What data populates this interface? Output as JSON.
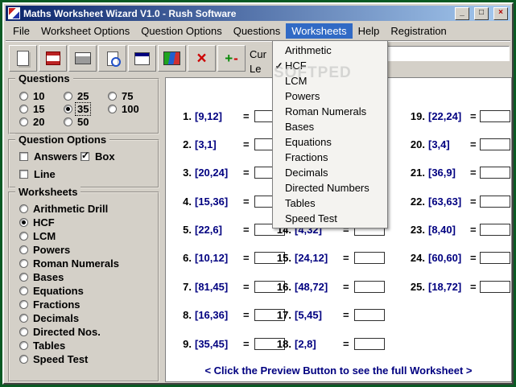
{
  "window": {
    "title": "Maths Worksheet Wizard V1.0 - Rush Software",
    "buttons": {
      "minimize": "_",
      "maximize": "□",
      "close": "×"
    }
  },
  "menubar": {
    "items": [
      {
        "label": "File",
        "active": false
      },
      {
        "label": "Worksheet Options",
        "active": false
      },
      {
        "label": "Question Options",
        "active": false
      },
      {
        "label": "Questions",
        "active": false
      },
      {
        "label": "Worksheets",
        "active": true
      },
      {
        "label": "Help",
        "active": false
      },
      {
        "label": "Registration",
        "active": false
      }
    ]
  },
  "dropdown": {
    "items": [
      {
        "label": "Arithmetic",
        "check": ""
      },
      {
        "label": "HCF",
        "check": "✓"
      },
      {
        "label": "LCM",
        "check": ""
      },
      {
        "label": "Powers",
        "check": ""
      },
      {
        "label": "Roman Numerals",
        "check": ""
      },
      {
        "label": "Bases",
        "check": ""
      },
      {
        "label": "Equations",
        "check": ""
      },
      {
        "label": "Fractions",
        "check": ""
      },
      {
        "label": "Decimals",
        "check": ""
      },
      {
        "label": "Directed Numbers",
        "check": ""
      },
      {
        "label": "Tables",
        "check": ""
      },
      {
        "label": "Speed Test",
        "check": ""
      }
    ]
  },
  "toolbar": {
    "buttons": [
      {
        "icon": "new-worksheet-icon"
      },
      {
        "icon": "save-worksheet-icon"
      },
      {
        "icon": "print-icon"
      },
      {
        "icon": "print-preview-icon"
      },
      {
        "icon": "preview-window-icon"
      },
      {
        "icon": "worksheet-image-icon"
      },
      {
        "icon": "delete-icon"
      },
      {
        "icon": "exit-icon"
      }
    ],
    "label_current": "Cur",
    "label_level": "Le",
    "input_value": ""
  },
  "panels": {
    "questions": {
      "title": "Questions",
      "options": [
        {
          "label": "10",
          "selected": false,
          "focused": false
        },
        {
          "label": "15",
          "selected": false,
          "focused": false
        },
        {
          "label": "20",
          "selected": false,
          "focused": false
        },
        {
          "label": "25",
          "selected": false,
          "focused": false
        },
        {
          "label": "35",
          "selected": true,
          "focused": true
        },
        {
          "label": "50",
          "selected": false,
          "focused": false
        },
        {
          "label": "75",
          "selected": false,
          "focused": false
        },
        {
          "label": "100",
          "selected": false,
          "focused": false
        }
      ]
    },
    "question_options": {
      "title": "Question Options",
      "checkboxes": [
        {
          "label": "Answers",
          "checked": false
        },
        {
          "label": "Box",
          "checked": true
        },
        {
          "label": "Line",
          "checked": false
        }
      ]
    },
    "worksheets": {
      "title": "Worksheets",
      "options": [
        {
          "label": "Arithmetic Drill",
          "selected": false
        },
        {
          "label": "HCF",
          "selected": true
        },
        {
          "label": "LCM",
          "selected": false
        },
        {
          "label": "Powers",
          "selected": false
        },
        {
          "label": "Roman Numerals",
          "selected": false
        },
        {
          "label": "Bases",
          "selected": false
        },
        {
          "label": "Equations",
          "selected": false
        },
        {
          "label": "Fractions",
          "selected": false
        },
        {
          "label": "Decimals",
          "selected": false
        },
        {
          "label": "Directed Nos.",
          "selected": false
        },
        {
          "label": "Tables",
          "selected": false
        },
        {
          "label": "Speed Test",
          "selected": false
        }
      ]
    }
  },
  "worksheet": {
    "equals": "=",
    "col1": [
      {
        "n": "1.",
        "pair": "[9,12]"
      },
      {
        "n": "2.",
        "pair": "[3,1]"
      },
      {
        "n": "3.",
        "pair": "[20,24]"
      },
      {
        "n": "4.",
        "pair": "[15,36]"
      },
      {
        "n": "5.",
        "pair": "[22,6]"
      },
      {
        "n": "6.",
        "pair": "[10,12]"
      },
      {
        "n": "7.",
        "pair": "[81,45]"
      },
      {
        "n": "8.",
        "pair": "[16,36]"
      },
      {
        "n": "9.",
        "pair": "[35,45]"
      }
    ],
    "col2": [
      {
        "n": "",
        "pair": "",
        "hidden": true
      },
      {
        "n": "",
        "pair": "",
        "hidden": true
      },
      {
        "n": "",
        "pair": "",
        "hidden": true
      },
      {
        "n": "",
        "pair": "",
        "hidden": true
      },
      {
        "n": "14.",
        "pair": "[4,32]"
      },
      {
        "n": "15.",
        "pair": "[24,12]"
      },
      {
        "n": "16.",
        "pair": "[48,72]"
      },
      {
        "n": "17.",
        "pair": "[5,45]"
      },
      {
        "n": "18.",
        "pair": "[2,8]"
      }
    ],
    "col3": [
      {
        "n": "19.",
        "pair": "[22,24]"
      },
      {
        "n": "20.",
        "pair": "[3,4]"
      },
      {
        "n": "21.",
        "pair": "[36,9]"
      },
      {
        "n": "22.",
        "pair": "[63,63]"
      },
      {
        "n": "23.",
        "pair": "[8,40]"
      },
      {
        "n": "24.",
        "pair": "[60,60]"
      },
      {
        "n": "25.",
        "pair": "[18,72]"
      }
    ],
    "hint": "< Click the Preview Button to see the full Worksheet >"
  },
  "watermark": "SOFTPED"
}
